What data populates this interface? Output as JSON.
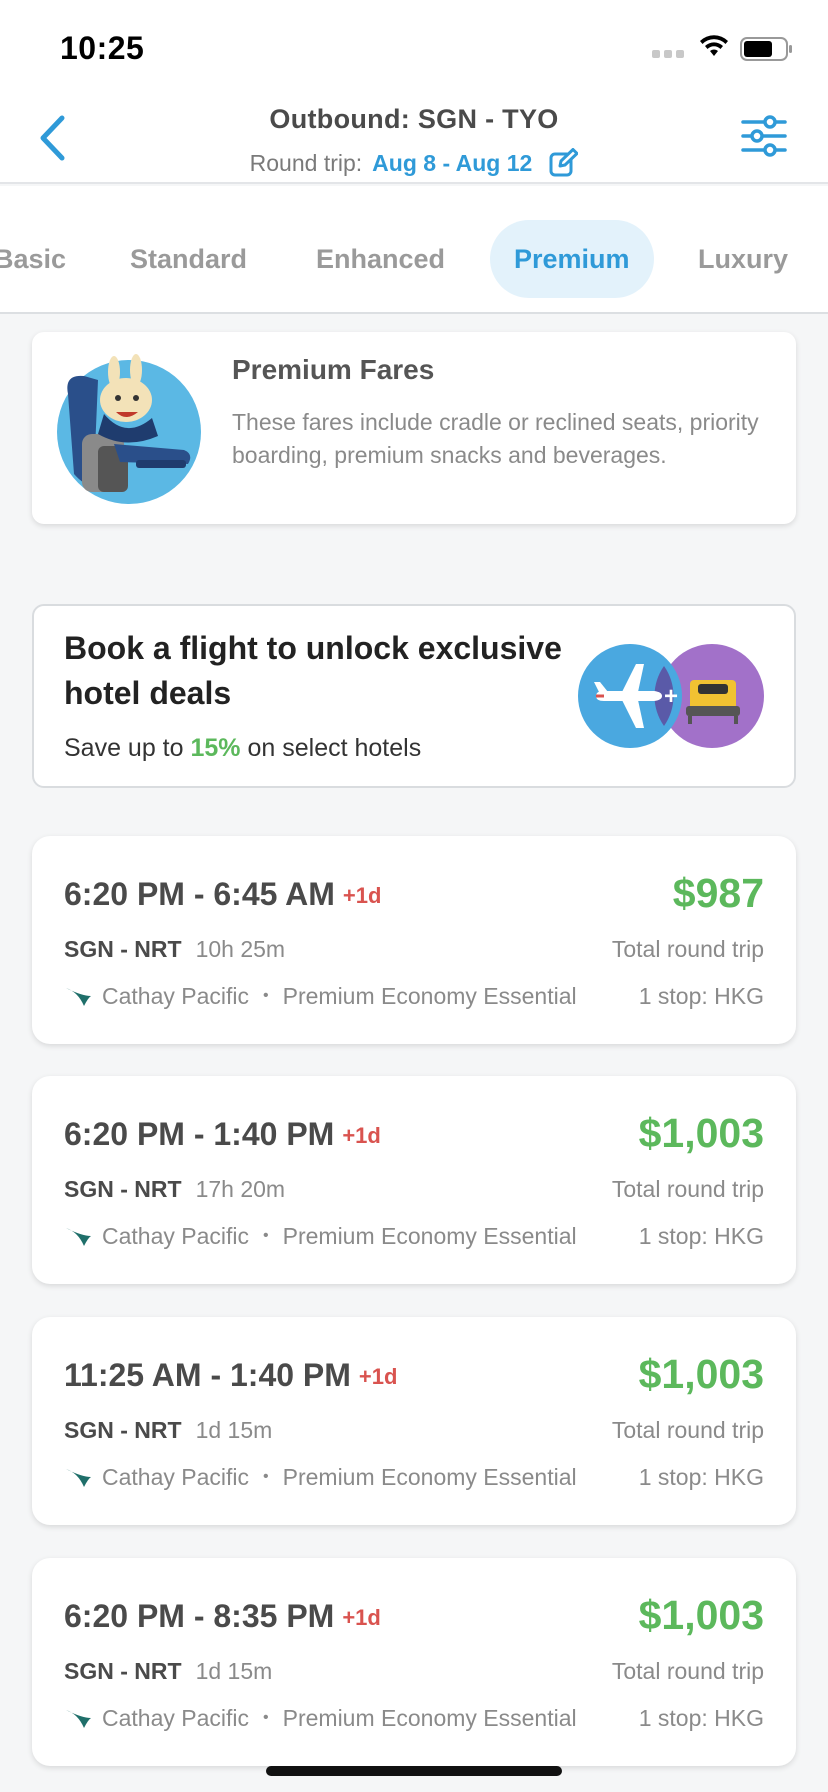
{
  "status_bar": {
    "time": "10:25"
  },
  "header": {
    "title": "Outbound: SGN - TYO",
    "trip_type": "Round trip:",
    "dates": "Aug 8 - Aug 12"
  },
  "tabs": [
    {
      "label": "Basic",
      "active": false
    },
    {
      "label": "Standard",
      "active": false
    },
    {
      "label": "Enhanced",
      "active": false
    },
    {
      "label": "Premium",
      "active": true
    },
    {
      "label": "Luxury",
      "active": false
    }
  ],
  "info_card": {
    "title": "Premium Fares",
    "description": "These fares include cradle or reclined seats, priority boarding, premium snacks and beverages."
  },
  "promo": {
    "title": "Book a flight to unlock exclusive hotel deals",
    "sub_prefix": "Save up to",
    "percent": "15%",
    "sub_suffix": "on select hotels"
  },
  "flights": [
    {
      "times": "6:20 PM - 6:45 AM",
      "day_offset": "+1d",
      "price": "$987",
      "route": "SGN - NRT",
      "duration": "10h 25m",
      "price_note": "Total round trip",
      "airline": "Cathay Pacific",
      "fare_class": "Premium Economy Essential",
      "stops": "1 stop: HKG"
    },
    {
      "times": "6:20 PM - 1:40 PM",
      "day_offset": "+1d",
      "price": "$1,003",
      "route": "SGN - NRT",
      "duration": "17h 20m",
      "price_note": "Total round trip",
      "airline": "Cathay Pacific",
      "fare_class": "Premium Economy Essential",
      "stops": "1 stop: HKG"
    },
    {
      "times": "11:25 AM - 1:40 PM",
      "day_offset": "+1d",
      "price": "$1,003",
      "route": "SGN - NRT",
      "duration": "1d 15m",
      "price_note": "Total round trip",
      "airline": "Cathay Pacific",
      "fare_class": "Premium Economy Essential",
      "stops": "1 stop: HKG"
    },
    {
      "times": "6:20 PM - 8:35 PM",
      "day_offset": "+1d",
      "price": "$1,003",
      "route": "SGN - NRT",
      "duration": "1d 15m",
      "price_note": "Total round trip",
      "airline": "Cathay Pacific",
      "fare_class": "Premium Economy Essential",
      "stops": "1 stop: HKG"
    }
  ],
  "colors": {
    "accent_blue": "#2f9ad8",
    "price_green": "#5cb85c",
    "day_offset_red": "#d9534f",
    "airline_teal": "#1f6f6a"
  },
  "icons": {
    "back": "chevron-left-icon",
    "edit": "edit-icon",
    "filter": "sliders-icon",
    "airline": "cathay-logo-icon",
    "promo_flight": "airplane-icon",
    "promo_hotel": "bed-icon"
  }
}
